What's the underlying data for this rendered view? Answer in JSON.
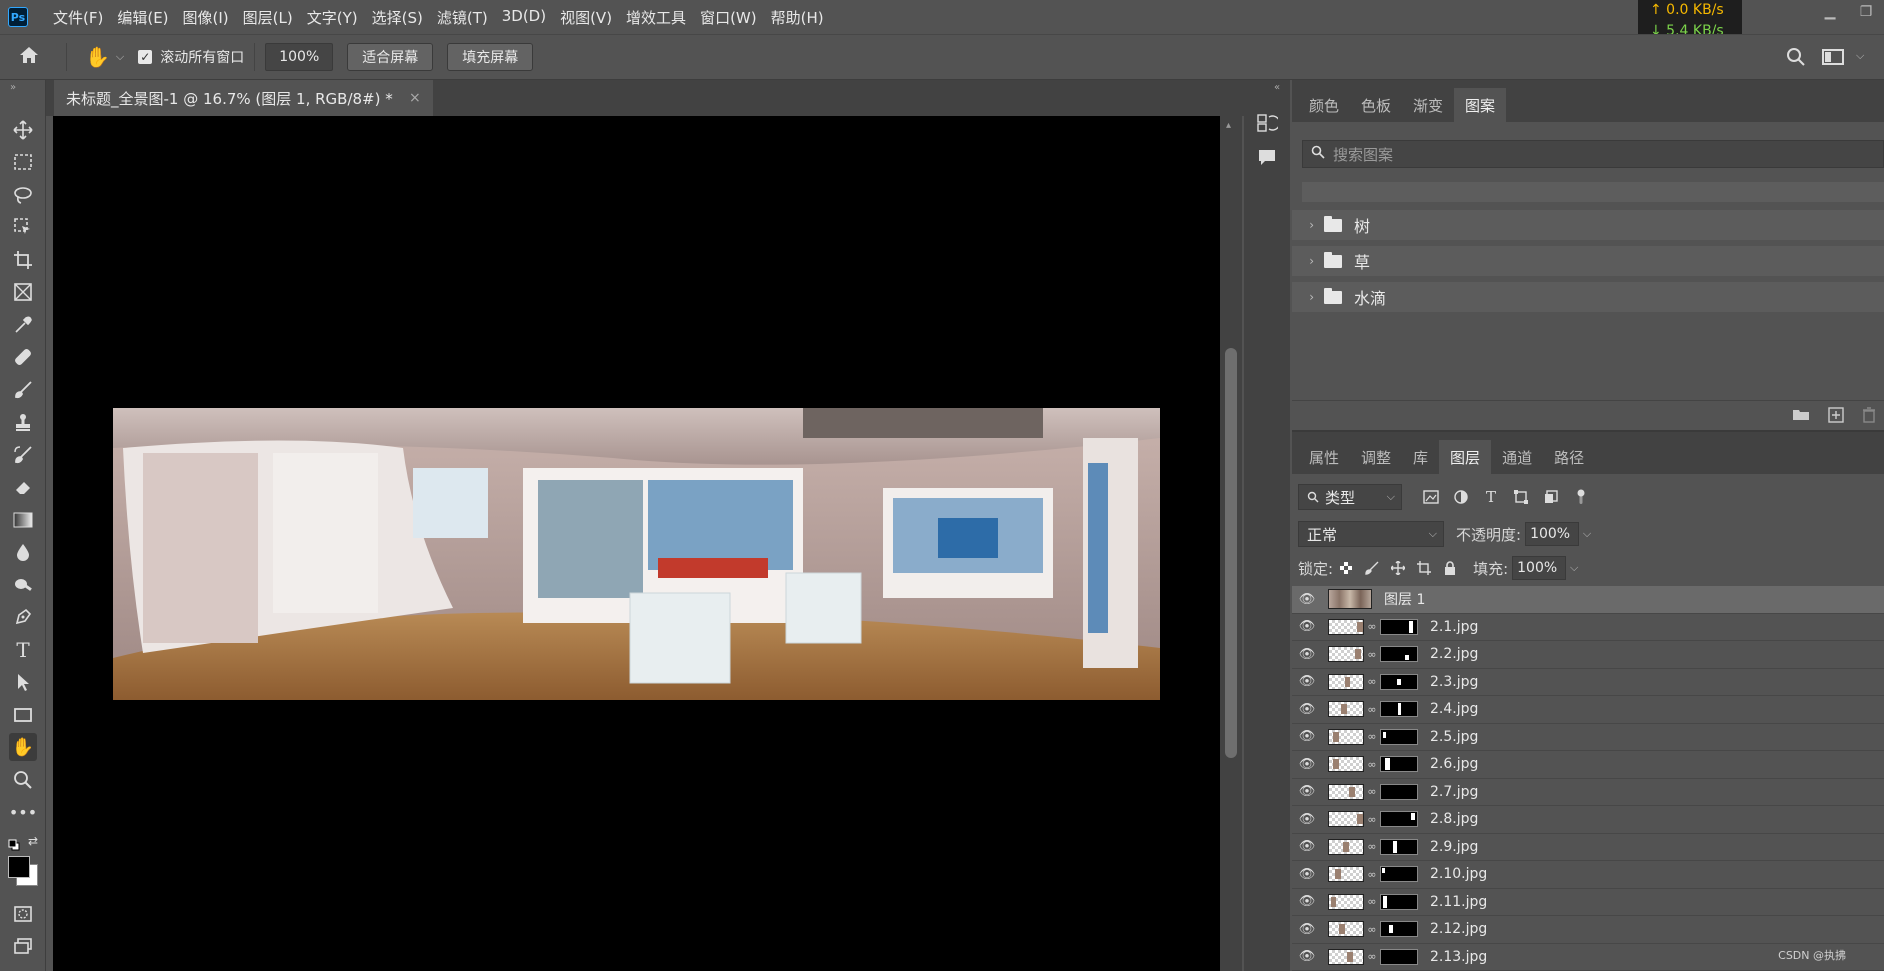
{
  "app": {
    "logo": "Ps"
  },
  "menu": [
    "文件(F)",
    "编辑(E)",
    "图像(I)",
    "图层(L)",
    "文字(Y)",
    "选择(S)",
    "滤镜(T)",
    "3D(D)",
    "视图(V)",
    "增效工具",
    "窗口(W)",
    "帮助(H)"
  ],
  "network": {
    "upload": "↑ 0.0 KB/s",
    "download": "↓ 5.4 KB/s"
  },
  "options": {
    "scroll_all_label": "滚动所有窗口",
    "zoom_value": "100%",
    "fit_screen_label": "适合屏幕",
    "fill_screen_label": "填充屏幕"
  },
  "document": {
    "tab_title": "未标题_全景图-1 @ 16.7% (图层 1, RGB/8#) *"
  },
  "patterns_panel": {
    "tabs": [
      "颜色",
      "色板",
      "渐变",
      "图案"
    ],
    "active_tab": "图案",
    "search_placeholder": "搜索图案",
    "groups": [
      "树",
      "草",
      "水滴"
    ]
  },
  "layers_panel": {
    "tabs": [
      "属性",
      "调整",
      "库",
      "图层",
      "通道",
      "路径"
    ],
    "active_tab": "图层",
    "kind_filter": "类型",
    "blend_mode": "正常",
    "opacity_label": "不透明度:",
    "opacity_value": "100%",
    "lock_label": "锁定:",
    "fill_label": "填充:",
    "fill_value": "100%",
    "layers": [
      "图层 1",
      "2.1.jpg",
      "2.2.jpg",
      "2.3.jpg",
      "2.4.jpg",
      "2.5.jpg",
      "2.6.jpg",
      "2.7.jpg",
      "2.8.jpg",
      "2.9.jpg",
      "2.10.jpg",
      "2.11.jpg",
      "2.12.jpg",
      "2.13.jpg"
    ]
  },
  "watermark": "CSDN @执拂",
  "icons": {
    "tools": [
      "move-icon",
      "marquee-icon",
      "lasso-icon",
      "object-select-icon",
      "crop-icon",
      "frame-icon",
      "eyedropper-icon",
      "healing-icon",
      "brush-icon",
      "stamp-icon",
      "history-brush-icon",
      "eraser-icon",
      "gradient-icon",
      "blur-icon",
      "dodge-icon",
      "pen-icon",
      "type-icon",
      "path-select-icon",
      "rectangle-icon",
      "hand-icon",
      "zoom-icon",
      "more-icon"
    ]
  }
}
